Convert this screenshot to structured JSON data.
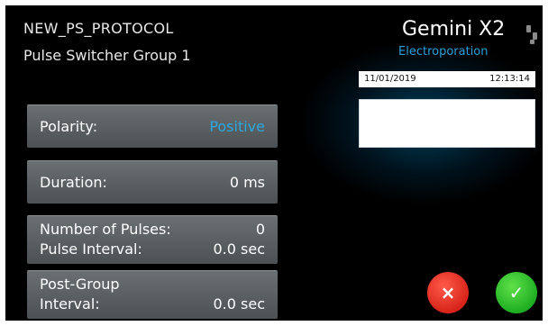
{
  "header": {
    "protocol_name": "NEW_PS_PROTOCOL",
    "group_name": "Pulse Switcher Group 1"
  },
  "device": {
    "title": "Gemini X2",
    "subtitle": "Electroporation",
    "date": "11/01/2019",
    "time": "12:13:14"
  },
  "panels": {
    "polarity": {
      "label": "Polarity:",
      "value": "Positive"
    },
    "duration": {
      "label": "Duration:",
      "value": "0 ms"
    },
    "pulses": {
      "label": "Number of Pulses:",
      "value": "0",
      "interval_label": "Pulse Interval:",
      "interval_value": "0.0 sec"
    },
    "post_group": {
      "label_line1": "Post-Group",
      "label_line2": "Interval:",
      "value": "0.0 sec"
    }
  },
  "actions": {
    "cancel_symbol": "×",
    "confirm_symbol": "✓"
  },
  "icons": [
    "menu-icon",
    "close-icon",
    "check-icon"
  ],
  "colors": {
    "accent_blue": "#2aa8e0",
    "panel_gray": "#5a5f62",
    "cancel_red": "#e02a1e",
    "confirm_green": "#25b52a"
  }
}
